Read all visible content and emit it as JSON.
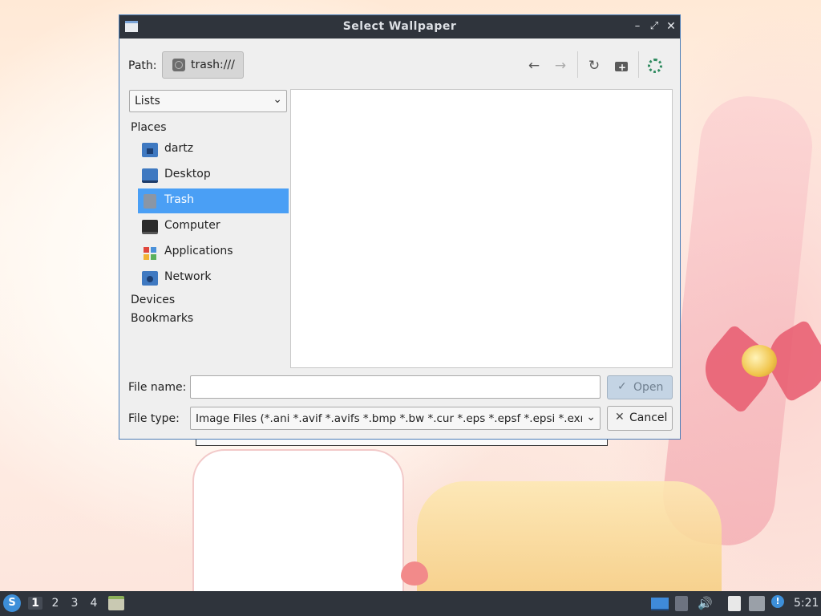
{
  "dialog": {
    "title": "Select Wallpaper",
    "path_label": "Path:",
    "path_value": "trash:///",
    "view_select_value": "Lists",
    "sidebar": {
      "places_header": "Places",
      "places": [
        {
          "label": "dartz",
          "icon": "home-folder-icon"
        },
        {
          "label": "Desktop",
          "icon": "desktop-icon"
        },
        {
          "label": "Trash",
          "icon": "trash-icon",
          "selected": true
        },
        {
          "label": "Computer",
          "icon": "computer-icon"
        },
        {
          "label": "Applications",
          "icon": "applications-icon"
        },
        {
          "label": "Network",
          "icon": "network-icon"
        }
      ],
      "devices_header": "Devices",
      "bookmarks_header": "Bookmarks"
    },
    "file_name_label": "File name:",
    "file_name_value": "",
    "file_type_label": "File type:",
    "file_type_value": "Image Files (*.ani *.avif *.avifs *.bmp *.bw *.cur *.eps *.epsf *.epsi *.exr *",
    "open_label": "Open",
    "cancel_label": "Cancel"
  },
  "taskbar": {
    "workspaces": [
      "1",
      "2",
      "3",
      "4"
    ],
    "active_workspace": "1",
    "clock": "5:21"
  },
  "colors": {
    "titlebar": "#2f343c",
    "selection": "#4a9ff5",
    "accent_border": "#4a7db8"
  }
}
